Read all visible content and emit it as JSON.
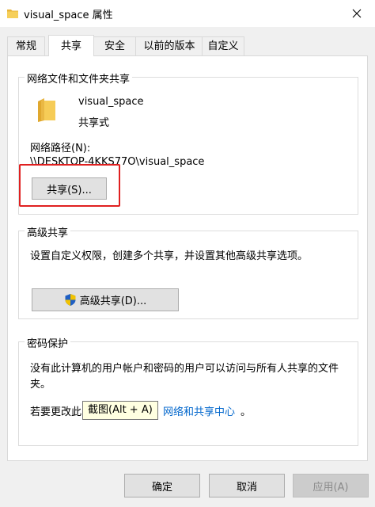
{
  "window": {
    "title": "visual_space 属性",
    "close_icon": "close-icon",
    "folder_icon": "folder-icon"
  },
  "tabs": [
    {
      "label": "常规"
    },
    {
      "label": "共享"
    },
    {
      "label": "安全"
    },
    {
      "label": "以前的版本"
    },
    {
      "label": "自定义"
    }
  ],
  "network_sharing": {
    "legend": "网络文件和文件夹共享",
    "folder_name": "visual_space",
    "share_status": "共享式",
    "path_label": "网络路径(N):",
    "path_value": "\\\\DESKTOP-4KKS77O\\visual_space",
    "share_button": "共享(S)..."
  },
  "advanced_sharing": {
    "legend": "高级共享",
    "description": "设置自定义权限，创建多个共享，并设置其他高级共享选项。",
    "button": "高级共享(D)...",
    "button_icon": "uac-shield-icon"
  },
  "password_protection": {
    "legend": "密码保护",
    "description_line1": "没有此计算机的用户帐户和密码的用户可以访问与所有人共享的文件",
    "description_line2": "夹。",
    "change_prefix": "若要更改此",
    "link_text": "网络和共享中心",
    "suffix": "。"
  },
  "tooltip": {
    "text": "截图(Alt + A)"
  },
  "footer": {
    "ok": "确定",
    "cancel": "取消",
    "apply": "应用(A)"
  },
  "colors": {
    "highlight_border": "#e02020",
    "link": "#0066cc",
    "folder": "#f4c542"
  }
}
